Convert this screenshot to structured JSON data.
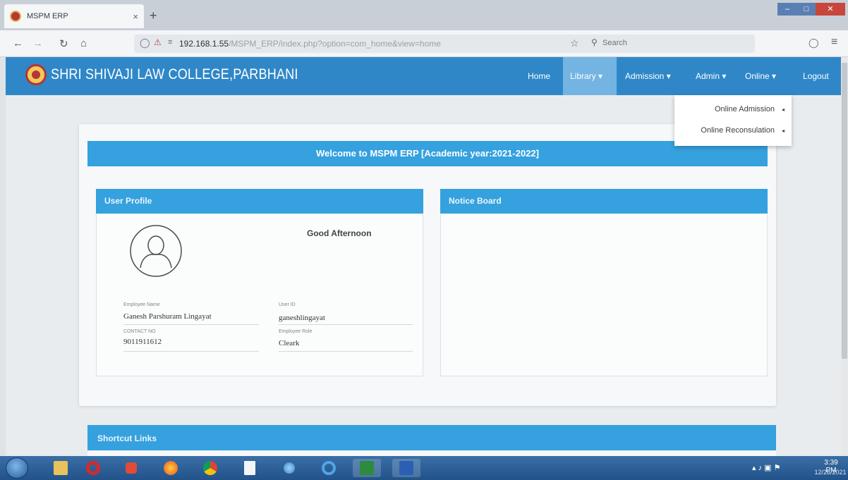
{
  "browser": {
    "tab_title": "MSPM ERP",
    "tab_close": "×",
    "new_tab": "+",
    "url_host": "192.168.1.55",
    "url_path": "/MSPM_ERP/index.php?option=com_home&view=home",
    "search_placeholder": "Search",
    "icons": [
      "back-arrow-icon",
      "forward-arrow-icon",
      "reload-icon",
      "home-icon",
      "shield-icon",
      "lock-icon",
      "star-icon",
      "search-icon",
      "pocket-icon",
      "menu-icon"
    ]
  },
  "header": {
    "brand": "SHRI SHIVAJI LAW COLLEGE,PARBHANI",
    "menu": {
      "home": "Home",
      "library": "Library ▾",
      "admission": "Admission ▾",
      "admin": "Admin ▾",
      "online": "Online ▾",
      "logout": "Logout"
    },
    "active_menu": "Library",
    "colors": {
      "header": "#2f87c8",
      "panel_header": "#35a1de",
      "active_item": "#73b4e2"
    }
  },
  "dropdown": {
    "items": [
      {
        "label": "Online Admission",
        "arrow": "◂"
      },
      {
        "label": "Online Reconsulation",
        "arrow": "◂"
      }
    ]
  },
  "welcome": {
    "text": "Welcome to MSPM ERP [Academic year:2021-2022]"
  },
  "profile": {
    "title": "User Profile",
    "greeting": "Good Afternoon",
    "employee_name_label": "Employee Name",
    "employee_name": "Ganesh Parshuram  Lingayat",
    "user_id_label": "User ID",
    "user_id": "ganeshlingayat",
    "contact_label": "CONTACT NO",
    "contact": "9011911612",
    "role_label": "Employee Role",
    "role": "Cleark"
  },
  "notice_board": {
    "title": "Notice Board"
  },
  "shortcut": {
    "title": "Shortcut Links"
  },
  "taskbar": {
    "time": "3:39 PM",
    "date": "12/28/2021",
    "apps": [
      "explorer-icon",
      "opera-icon",
      "media-player-icon",
      "firefox-icon",
      "chrome-icon",
      "notepad-icon",
      "network-icon",
      "ie-icon",
      "excel-icon",
      "word-icon"
    ]
  }
}
